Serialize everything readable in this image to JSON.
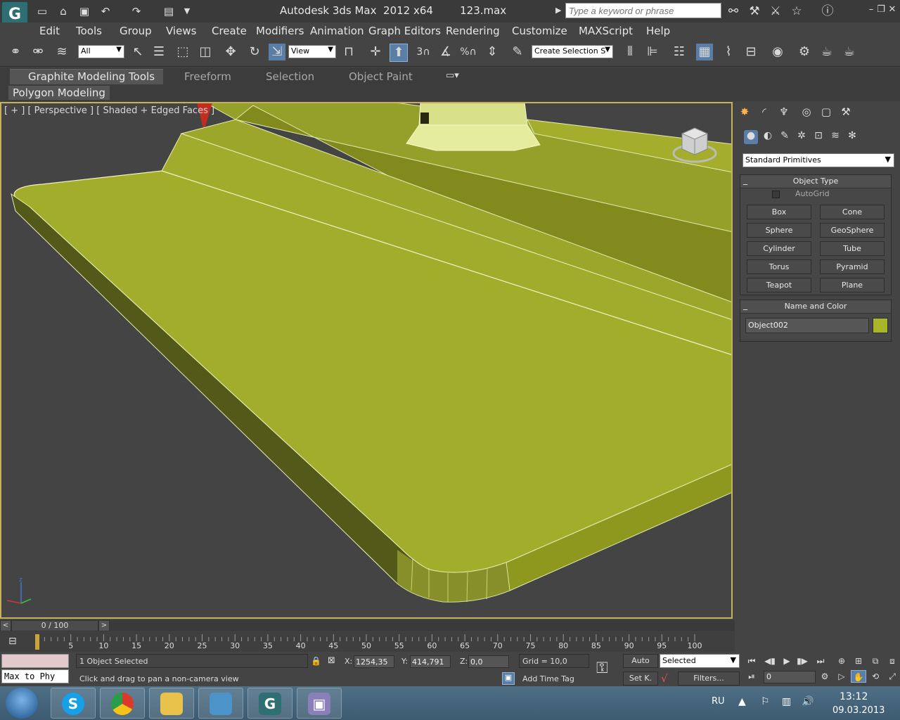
{
  "title_bar": {
    "app_title": "Autodesk 3ds Max  2012 x64",
    "file_name": "123.max",
    "search_placeholder": "Type a keyword or phrase"
  },
  "menu": {
    "items": [
      "Edit",
      "Tools",
      "Group",
      "Views",
      "Create",
      "Modifiers",
      "Animation",
      "Graph Editors",
      "Rendering",
      "Customize",
      "MAXScript",
      "Help"
    ]
  },
  "toolbar": {
    "selection_filter": "All",
    "reference_coord": "View",
    "named_selection": "Create Selection S",
    "snap_label_3": "3",
    "percent_label": "%"
  },
  "ribbon": {
    "tabs": [
      "Graphite Modeling Tools",
      "Freeform",
      "Selection",
      "Object Paint"
    ],
    "panel_label": "Polygon Modeling"
  },
  "viewport": {
    "label": "[ + ] [ Perspective ] [ Shaded + Edged Faces ]",
    "object_color": "#a8ab27"
  },
  "command_panel": {
    "category_dropdown": "Standard Primitives",
    "object_type_title": "Object Type",
    "autogrid_label": "AutoGrid",
    "buttons": [
      "Box",
      "Cone",
      "Sphere",
      "GeoSphere",
      "Cylinder",
      "Tube",
      "Torus",
      "Pyramid",
      "Teapot",
      "Plane"
    ],
    "name_color_title": "Name and Color",
    "object_name": "Object002",
    "object_color": "#a9b52b"
  },
  "time": {
    "slider_label": "0 / 100",
    "ticks": [
      "5",
      "10",
      "15",
      "20",
      "25",
      "30",
      "35",
      "40",
      "45",
      "50",
      "55",
      "60",
      "65",
      "70",
      "75",
      "80",
      "85",
      "90",
      "95",
      "100"
    ]
  },
  "status": {
    "maxscript_text": "Max to Phy",
    "selection_count": "1 Object Selected",
    "prompt": "Click and drag to pan a non-camera view",
    "x_label": "X:",
    "x_value": "1254,35",
    "y_label": "Y:",
    "y_value": "414,791",
    "z_label": "Z:",
    "z_value": "0,0",
    "grid": "Grid = 10,0",
    "add_time_tag": "Add Time Tag",
    "auto_key": "Auto",
    "set_key": "Set K.",
    "key_filter": "Selected",
    "filters": "Filters...",
    "frame": "0"
  },
  "taskbar": {
    "language": "RU",
    "time": "13:12",
    "date": "09.03.2013"
  }
}
